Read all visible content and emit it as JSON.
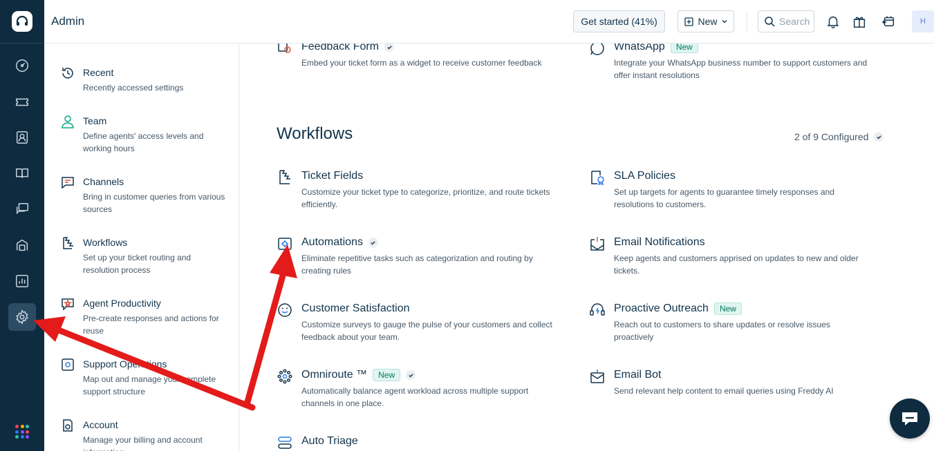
{
  "header": {
    "title": "Admin",
    "get_started": "Get started (41%)",
    "new_label": "New",
    "search_placeholder": "Search",
    "avatar_initial": "H"
  },
  "sidebar": {
    "items": [
      {
        "label": "Recent",
        "desc": "Recently accessed settings",
        "icon": "history-icon"
      },
      {
        "label": "Team",
        "desc": "Define agents' access levels and working hours",
        "icon": "user-icon"
      },
      {
        "label": "Channels",
        "desc": "Bring in customer queries from various sources",
        "icon": "chat-icon"
      },
      {
        "label": "Workflows",
        "desc": "Set up your ticket routing and resolution process",
        "icon": "workflow-icon"
      },
      {
        "label": "Agent Productivity",
        "desc": "Pre-create responses and actions for reuse",
        "icon": "productivity-icon"
      },
      {
        "label": "Support Operations",
        "desc": "Map out and manage your complete support structure",
        "icon": "operations-icon"
      },
      {
        "label": "Account",
        "desc": "Manage your billing and account information",
        "icon": "account-icon"
      }
    ]
  },
  "channels_cards": {
    "feedback_form": {
      "title": "Feedback Form",
      "desc": "Embed your ticket form as a widget to receive customer feedback"
    },
    "whatsapp": {
      "title": "WhatsApp",
      "badge": "New",
      "desc": "Integrate your WhatsApp business number to support customers and offer instant resolutions"
    }
  },
  "workflows": {
    "title": "Workflows",
    "configured": "2 of 9 Configured",
    "cards": [
      {
        "title": "Ticket Fields",
        "desc": "Customize your ticket type to categorize, prioritize, and route tickets efficiently."
      },
      {
        "title": "SLA Policies",
        "desc": "Set up targets for agents to guarantee timely responses and resolutions to customers."
      },
      {
        "title": "Automations",
        "desc": "Eliminate repetitive tasks such as categorization and routing by creating rules"
      },
      {
        "title": "Email Notifications",
        "desc": "Keep agents and customers apprised on updates to new and older tickets."
      },
      {
        "title": "Customer Satisfaction",
        "desc": "Customize surveys to gauge the pulse of your customers and collect feedback about your team."
      },
      {
        "title": "Proactive Outreach",
        "badge": "New",
        "desc": "Reach out to customers to share updates or resolve issues proactively"
      },
      {
        "title": "Omniroute ™",
        "badge": "New",
        "desc": "Automatically balance agent workload across multiple support channels in one place."
      },
      {
        "title": "Email Bot",
        "desc": "Send relevant help content to email queries using Freddy AI"
      },
      {
        "title": "Auto Triage",
        "desc": ""
      }
    ]
  },
  "colors": {
    "rail_bg": "#0f2b3f",
    "text": "#12344d",
    "annotation_arrow": "#e31b1b"
  }
}
